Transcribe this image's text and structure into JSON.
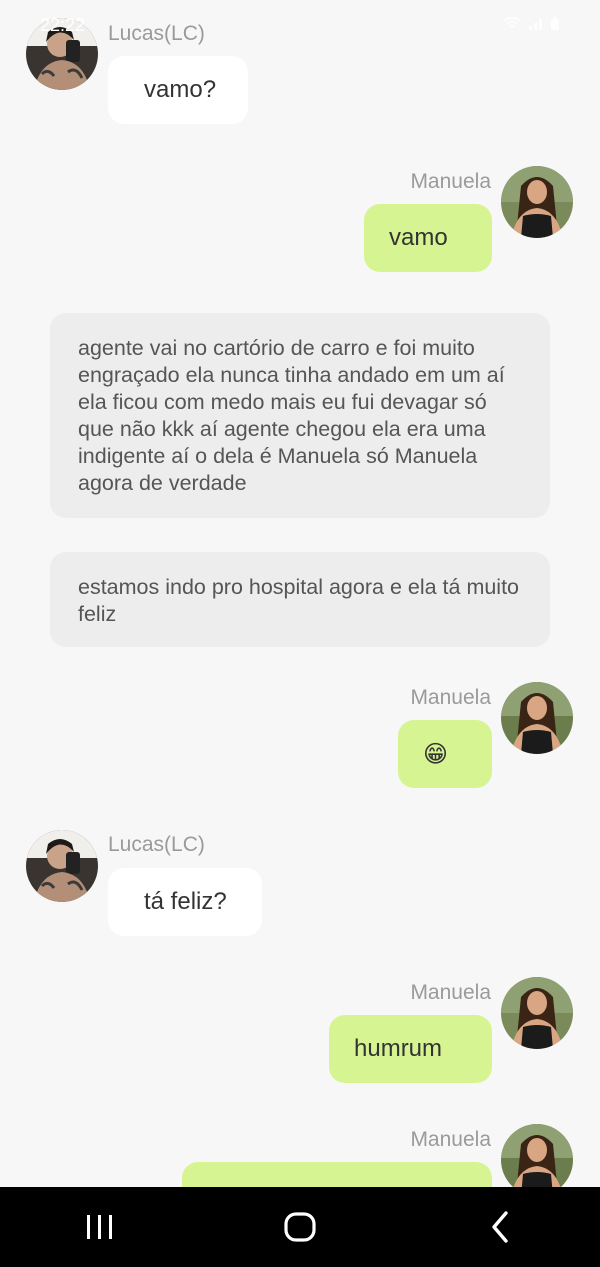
{
  "status": {
    "time": "22:22"
  },
  "messages": [
    {
      "sender": "Lucas(LC)",
      "text": "vamo?"
    },
    {
      "sender": "Manuela",
      "text": "vamo"
    },
    {
      "text": "agente vai no cartório de carro e foi muito engraçado ela nunca tinha andado em um aí ela ficou com medo mais eu fui devagar só que não kkk aí agente chegou ela era uma indigente aí o dela é Manuela só Manuela agora de verdade"
    },
    {
      "text": "estamos indo pro hospital agora e ela tá muito feliz"
    },
    {
      "sender": "Manuela",
      "text": "😁"
    },
    {
      "sender": "Lucas(LC)",
      "text": "tá feliz?"
    },
    {
      "sender": "Manuela",
      "text": "humrum"
    },
    {
      "sender": "Manuela",
      "text": ""
    }
  ],
  "nav": {
    "recent": "recent-apps-icon",
    "home": "home-icon",
    "back": "back-icon"
  },
  "colors": {
    "outgoing_bubble": "#d6f592",
    "incoming_bubble": "#ffffff",
    "narration_bubble": "#ededed",
    "background": "#f7f7f7"
  }
}
